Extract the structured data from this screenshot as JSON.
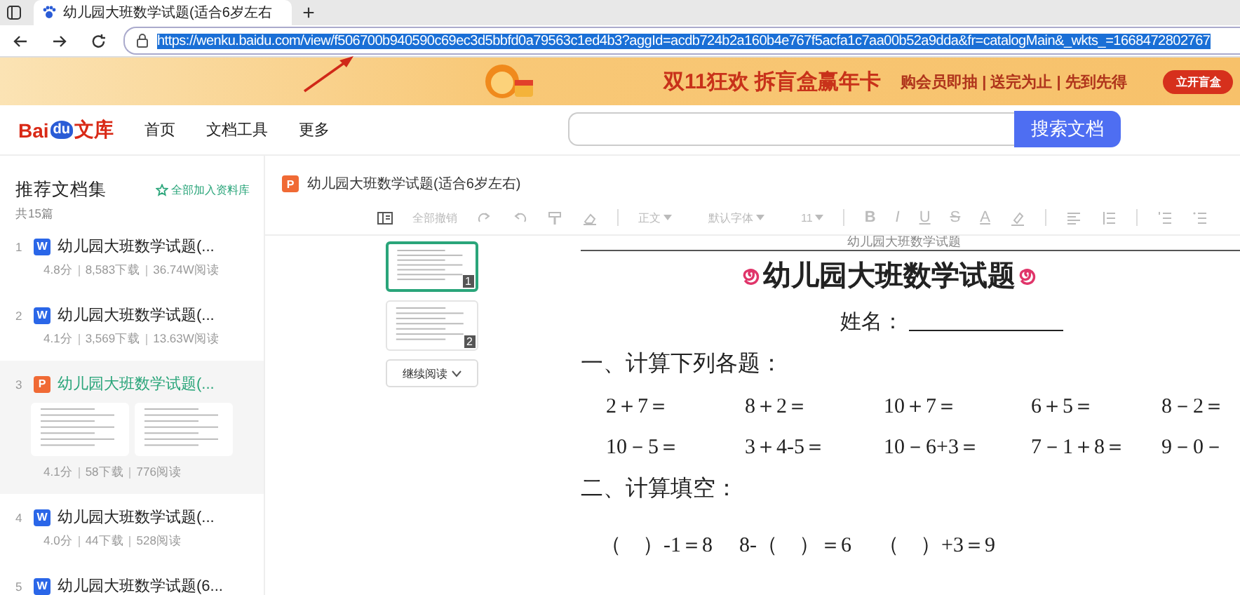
{
  "browser": {
    "tab_title": "幼儿园大班数学试题(适合6岁左右",
    "new_tab": "+",
    "url": "https://wenku.baidu.com/view/f506700b940590c69ec3d5bbfd0a79563c1ed4b3?aggId=acdb724b2a160b4e767f5acfa1c7aa00b52a9dda&fr=catalogMain&_wkts_=1668472802767"
  },
  "banner": {
    "headline": "双11狂欢 拆盲盒赢年卡",
    "subline": "购会员即抽 | 送完为止 | 先到先得",
    "button": "立开盲盒"
  },
  "header": {
    "logo": [
      "Bai",
      "du",
      "文库"
    ],
    "nav": [
      {
        "label": "首页"
      },
      {
        "label": "文档工具"
      },
      {
        "label": "更多"
      }
    ],
    "search_button": "搜索文档"
  },
  "sidebar": {
    "title": "推荐文档集",
    "add_all": "全部加入资料库",
    "count": "共15篇",
    "items": [
      {
        "index": "1",
        "badge": "W",
        "color": "#2a66e8",
        "title": "幼儿园大班数学试题(...",
        "meta": [
          "4.8分",
          "8,583下载",
          "36.74W阅读"
        ],
        "selected": false
      },
      {
        "index": "2",
        "badge": "W",
        "color": "#2a66e8",
        "title": "幼儿园大班数学试题(...",
        "meta": [
          "4.1分",
          "3,569下载",
          "13.63W阅读"
        ],
        "selected": false
      },
      {
        "index": "3",
        "badge": "P",
        "color": "#f06a35",
        "title": "幼儿园大班数学试题(...",
        "meta": [
          "4.1分",
          "58下载",
          "776阅读"
        ],
        "selected": true
      },
      {
        "index": "4",
        "badge": "W",
        "color": "#2a66e8",
        "title": "幼儿园大班数学试题(...",
        "meta": [
          "4.0分",
          "44下载",
          "528阅读"
        ],
        "selected": false
      },
      {
        "index": "5",
        "badge": "W",
        "color": "#2a66e8",
        "title": "幼儿园大班数学试题(6...",
        "selected": false
      }
    ]
  },
  "document": {
    "badge": "P",
    "title": "幼儿园大班数学试题(适合6岁左右)",
    "toolbar": {
      "undo_all": "全部撤销",
      "style": "正文",
      "font": "默认字体",
      "size": "11",
      "bold": "B",
      "italic": "I",
      "underline": "U",
      "strike": "S",
      "font_color": "A"
    },
    "thumbnails": [
      {
        "number": "1",
        "selected": true
      },
      {
        "number": "2",
        "selected": false
      }
    ],
    "continue_button": "继续阅读",
    "page": {
      "running_title": "幼儿园大班数学试题",
      "title": "幼儿园大班数学试题",
      "name_label": "姓名：",
      "sections": [
        {
          "heading": "一、计算下列各题：",
          "rows": [
            [
              "2＋7＝",
              "8＋2＝",
              "10＋7＝",
              "6＋5＝",
              "8－2＝"
            ],
            [
              "10－5＝",
              "3＋4-5＝",
              "10－6+3＝",
              "7－1＋8＝",
              "9－0－"
            ]
          ]
        },
        {
          "heading": "二、计算填空：",
          "rows": [
            [
              "（　）-1＝8",
              "8-（　）＝6",
              "（　）+3＝9"
            ]
          ]
        }
      ]
    }
  }
}
